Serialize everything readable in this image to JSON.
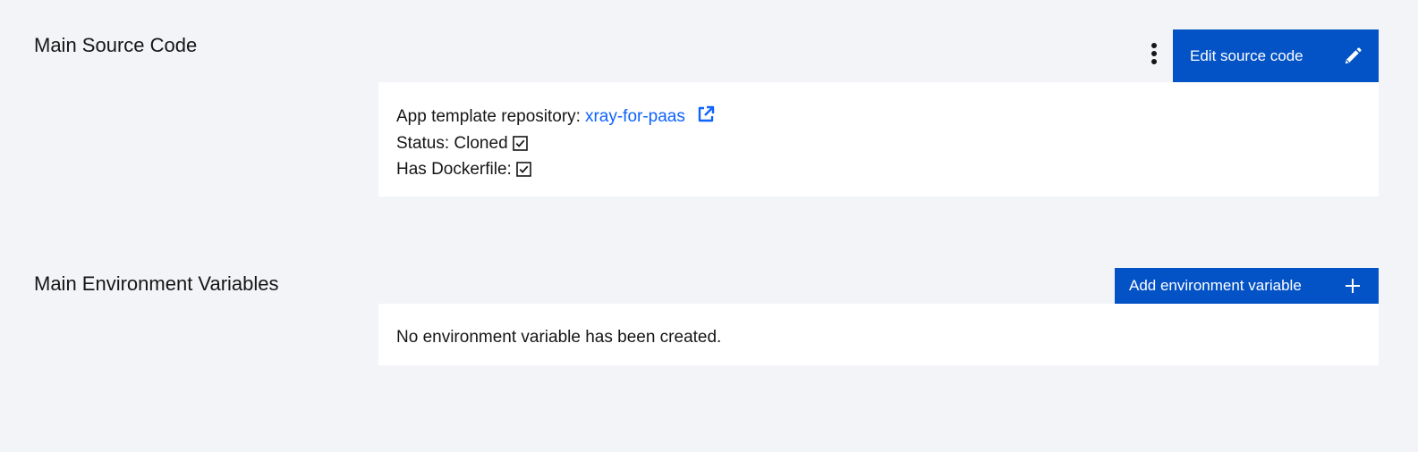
{
  "source_section": {
    "title": "Main Source Code",
    "edit_button_label": "Edit source code",
    "repository_label": "App template repository:",
    "repository_link_text": "xray-for-paas",
    "status_label": "Status: Cloned",
    "dockerfile_label": "Has Dockerfile:"
  },
  "env_section": {
    "title": "Main Environment Variables",
    "add_button_label": "Add environment variable",
    "empty_message": "No environment variable has been created."
  },
  "colors": {
    "background": "#f3f4f8",
    "panel": "#ffffff",
    "primary_button": "#0353c7",
    "link": "#0f62fe",
    "text": "#161616"
  },
  "icons": {
    "overflow": "overflow-menu-vertical-icon",
    "edit": "pencil-icon",
    "external_link": "external-link-icon",
    "checked": "checkbox-checked-icon",
    "add": "plus-icon"
  }
}
